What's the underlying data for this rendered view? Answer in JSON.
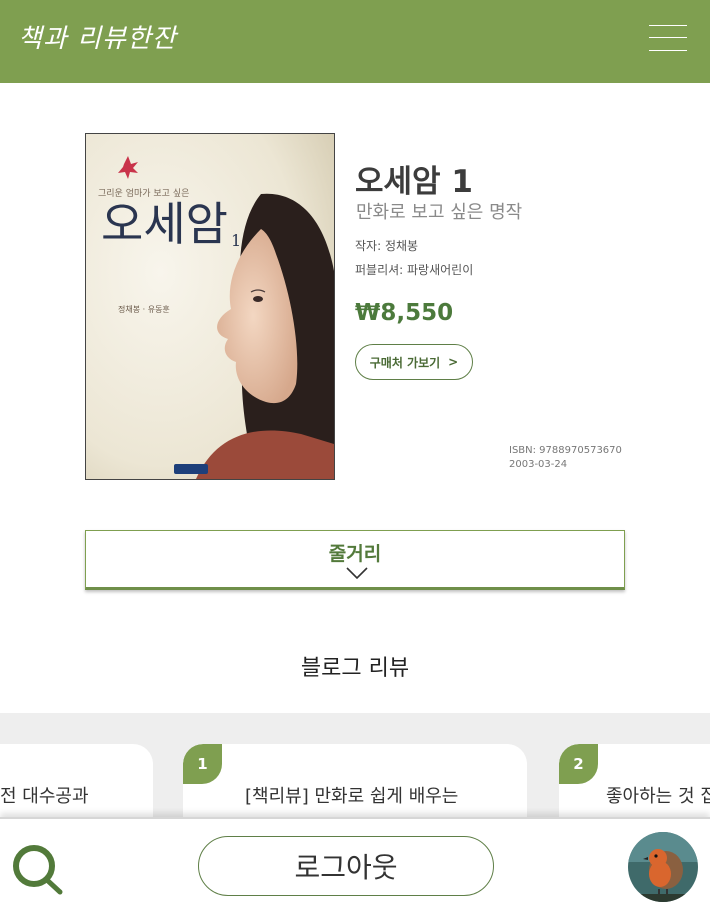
{
  "header": {
    "logo_text": "책과 리뷰한잔",
    "menu_icon": "hamburger-icon"
  },
  "book": {
    "cover_text": "오세암",
    "cover_number": "1",
    "title": "오세암 1",
    "subtitle": "만화로 보고 싶은 명작",
    "author": "작자: 정채봉",
    "publisher": "퍼블리셔: 파랑새어린이",
    "price": "₩8,550",
    "buy_label": "구매처 가보기",
    "buy_arrow": ">",
    "isbn": "ISBN: 9788970573670",
    "date": "2003-03-24"
  },
  "plot": {
    "label": "줄거리",
    "icon": "chevron-down-icon"
  },
  "blog": {
    "heading": "블로그 리뷰",
    "cards": [
      {
        "badge": "",
        "text": "전 대수공과"
      },
      {
        "badge": "1",
        "text": "[책리뷰] 만화로 쉽게 배우는"
      },
      {
        "badge": "2",
        "text": "좋아하는 것 집"
      }
    ]
  },
  "bottom_bar": {
    "search_icon": "search-icon",
    "logout_label": "로그아웃",
    "avatar_icon": "robin-bird-avatar"
  },
  "colors": {
    "brand_green": "#7f9f50",
    "price_green": "#4c7a3c"
  }
}
